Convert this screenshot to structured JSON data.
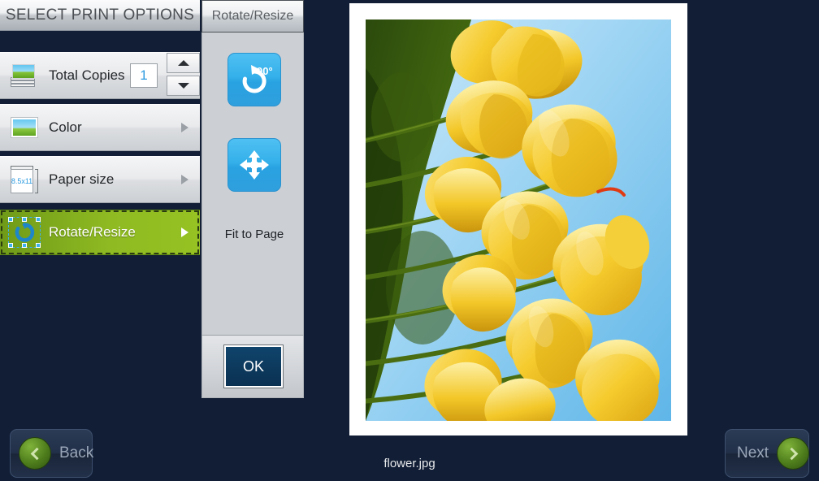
{
  "window": {
    "background_color": "#111e35"
  },
  "options_panel": {
    "title": "SELECT PRINT OPTIONS",
    "rows": [
      {
        "label": "Total Copies",
        "icon": "photo-stack-icon",
        "has_arrow": false
      },
      {
        "label": "Color",
        "icon": "photo-icon",
        "has_arrow": true
      },
      {
        "label": "Paper size",
        "icon": "paper-size-icon",
        "has_arrow": true
      },
      {
        "label": "Rotate/Resize",
        "icon": "rotate-icon",
        "has_arrow": true,
        "selected": true
      }
    ],
    "copies": {
      "value": "1",
      "increment_icon": "triangle-up-icon",
      "decrement_icon": "triangle-down-icon"
    },
    "paper_size_icon_label": "8.5x11",
    "selected_color": "#8fba22"
  },
  "sub_panel": {
    "tab_label": "Rotate/Resize",
    "tools": [
      {
        "label": "Rotate",
        "icon": "rotate-90-icon",
        "badge": "90°"
      },
      {
        "label": "Fit to Page",
        "icon": "four-way-arrow-icon"
      }
    ],
    "ok_label": "OK",
    "accent_color": "#34b0ea"
  },
  "preview": {
    "file_name": "flower.jpg",
    "image_description": "yellow tulips against blue sky",
    "sky_color": "#8fd0f2",
    "flower_color": "#f2c322",
    "leaf_color": "#3f5c12"
  },
  "navigation": {
    "back_label": "Back",
    "back_icon": "chevron-left-icon",
    "next_label": "Next",
    "next_icon": "chevron-right-icon",
    "button_color": "#223049",
    "circle_color": "#4e7d1c"
  }
}
